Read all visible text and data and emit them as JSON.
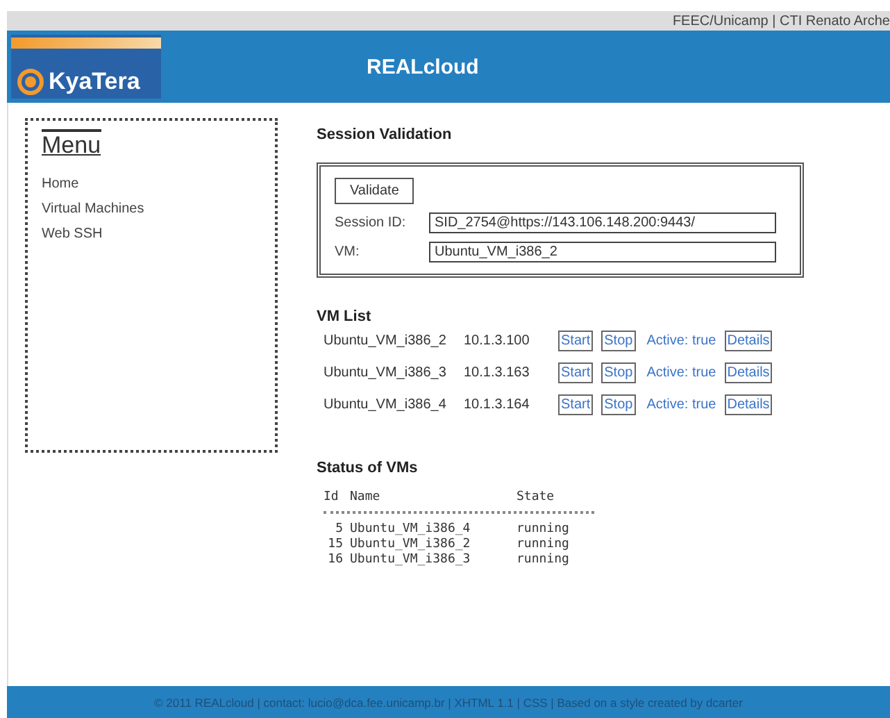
{
  "top_bar": {
    "text": "FEEC/Unicamp | CTI Renato Arche"
  },
  "header": {
    "logo_text": "KyaTera",
    "title": "REALcloud"
  },
  "menu": {
    "title": "Menu",
    "items": [
      {
        "label": "Home"
      },
      {
        "label": "Virtual Machines"
      },
      {
        "label": "Web SSH"
      }
    ]
  },
  "session_validation": {
    "title": "Session Validation",
    "button": "Validate",
    "fields": [
      {
        "label": "Session ID:",
        "value": "SID_2754@https://143.106.148.200:9443/"
      },
      {
        "label": "VM:",
        "value": "Ubuntu_VM_i386_2"
      }
    ]
  },
  "vm_list": {
    "title": "VM List",
    "rows": [
      {
        "name": "Ubuntu_VM_i386_2",
        "ip": "10.1.3.100",
        "start": "Start",
        "stop": "Stop",
        "status": "Active: true",
        "details": "Details"
      },
      {
        "name": "Ubuntu_VM_i386_3",
        "ip": "10.1.3.163",
        "start": "Start",
        "stop": "Stop",
        "status": "Active: true",
        "details": "Details"
      },
      {
        "name": "Ubuntu_VM_i386_4",
        "ip": "10.1.3.164",
        "start": "Start",
        "stop": "Stop",
        "status": "Active: true",
        "details": "Details"
      }
    ]
  },
  "status": {
    "title": "Status of VMs",
    "columns": [
      "Id",
      "Name",
      "State"
    ],
    "rows": [
      {
        "id": "5",
        "name": "Ubuntu_VM_i386_4",
        "state": "running"
      },
      {
        "id": "15",
        "name": "Ubuntu_VM_i386_2",
        "state": "running"
      },
      {
        "id": "16",
        "name": "Ubuntu_VM_i386_3",
        "state": "running"
      }
    ]
  },
  "footer": {
    "text": "© 2011 REALcloud | contact: lucio@dca.fee.unicamp.br | XHTML 1.1 | CSS | Based on a style created by dcarter"
  }
}
